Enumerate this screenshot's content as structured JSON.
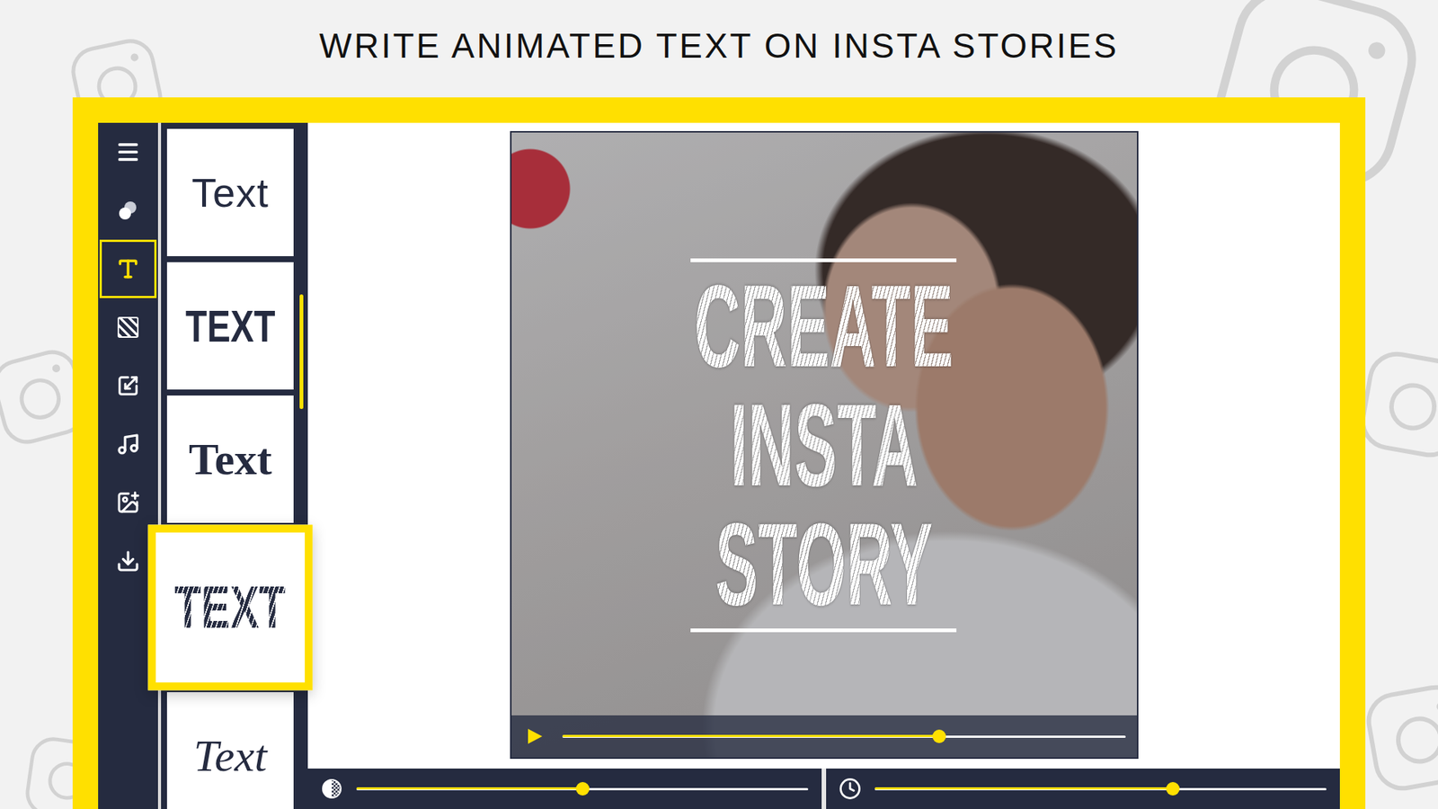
{
  "title": "WRITE ANIMATED TEXT ON INSTA STORIES",
  "sidebar": {
    "items": [
      {
        "selected": false
      },
      {
        "selected": false
      },
      {
        "selected": true
      },
      {
        "selected": false
      },
      {
        "selected": false
      },
      {
        "selected": false
      },
      {
        "selected": false
      },
      {
        "selected": false
      }
    ]
  },
  "text_styles": [
    {
      "label": "Text",
      "kind": "sans",
      "selected": false
    },
    {
      "label": "TEXT",
      "kind": "condensed",
      "selected": false
    },
    {
      "label": "Text",
      "kind": "serif",
      "selected": false
    },
    {
      "label": "TEXT",
      "kind": "striped",
      "selected": true
    },
    {
      "label": "Text",
      "kind": "script",
      "selected": false
    }
  ],
  "preview": {
    "lines": [
      "CREATE",
      "INSTA",
      "STORY"
    ],
    "player": {
      "playing": false,
      "level": 0.67
    }
  },
  "controls": [
    {
      "kind": "opacity",
      "level": 0.5
    },
    {
      "kind": "duration",
      "level": 0.66
    }
  ]
}
